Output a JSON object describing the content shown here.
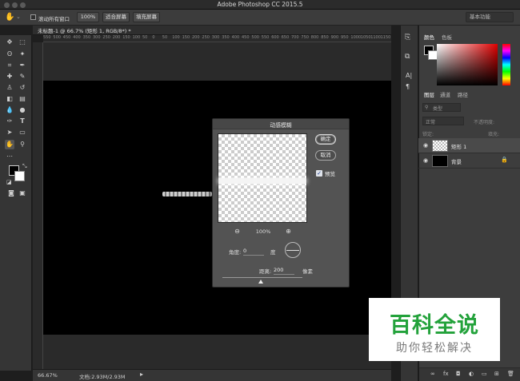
{
  "window": {
    "app_title": "Adobe Photoshop CC 2015.5"
  },
  "options_bar": {
    "scroll_all_label": "滚动所有窗口",
    "zoom_value": "100%",
    "fit_screen_label": "适合屏幕",
    "fill_screen_label": "填充屏幕",
    "workspace_label": "基本功能"
  },
  "document": {
    "tab_label": "未标题-1 @ 66.7% (矩形 1, RGB/8*) *",
    "ruler_ticks": [
      "550",
      "500",
      "450",
      "400",
      "350",
      "300",
      "250",
      "200",
      "150",
      "100",
      "50",
      "0",
      "50",
      "100",
      "150",
      "200",
      "250",
      "300",
      "350",
      "400",
      "450",
      "500",
      "550",
      "600",
      "650",
      "700",
      "750",
      "800",
      "850",
      "900",
      "950",
      "1000",
      "1050",
      "1100",
      "1150"
    ]
  },
  "status": {
    "zoom": "66.67%",
    "doc_size": "文档:2.93M/2.93M"
  },
  "panels": {
    "color_tab": "颜色",
    "swatches_tab": "色板",
    "layers_tab": "图层",
    "channels_tab": "通道",
    "paths_tab": "路径",
    "kind_label": "类型",
    "blend_mode": "正常",
    "opacity_label": "不透明度:",
    "lock_label": "锁定:",
    "fill_label": "填充:",
    "layers": [
      {
        "name": "矩形 1"
      },
      {
        "name": "背景"
      }
    ]
  },
  "dialog": {
    "title": "动感模糊",
    "ok_label": "确定",
    "cancel_label": "取消",
    "preview_label": "预览",
    "zoom_level": "100%",
    "angle_label": "角度:",
    "angle_value": "0",
    "angle_unit": "度",
    "distance_label": "距离:",
    "distance_value": "200",
    "distance_unit": "像素"
  },
  "watermark": {
    "title": "百科全说",
    "subtitle": "助你轻松解决"
  }
}
